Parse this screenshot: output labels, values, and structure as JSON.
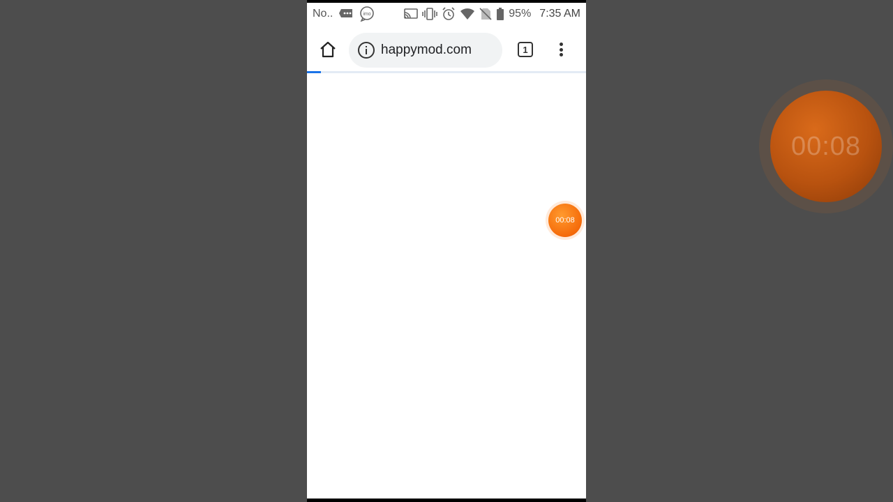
{
  "status_bar": {
    "notification_text": "No..",
    "imo_label": "imo",
    "battery": "95%",
    "time": "7:35 AM"
  },
  "browser": {
    "url": "happymod.com",
    "tab_count": "1",
    "load_progress_fraction": 0.05
  },
  "recorder": {
    "timer": "00:08",
    "accent_color": "#f56b0a"
  }
}
